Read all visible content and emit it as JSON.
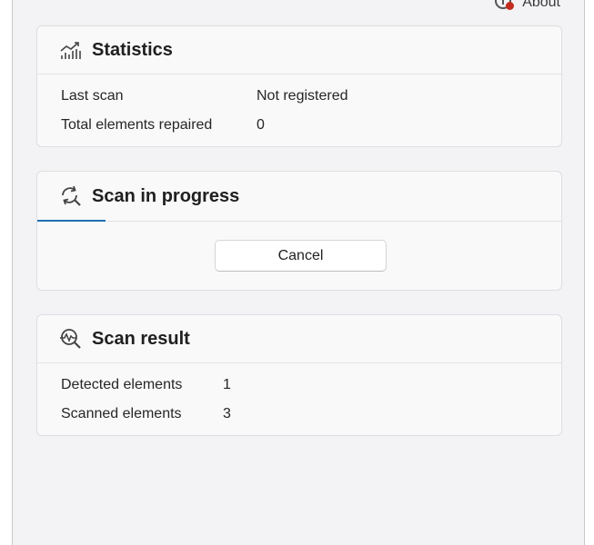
{
  "header": {
    "about_label": "About",
    "about_icon": "info-icon",
    "notification_color": "#c42b1c"
  },
  "statistics": {
    "title": "Statistics",
    "icon": "chart-icon",
    "rows": [
      {
        "label": "Last scan",
        "value": "Not registered"
      },
      {
        "label": "Total elements repaired",
        "value": "0"
      }
    ]
  },
  "scan_progress": {
    "title": "Scan in progress",
    "icon": "refresh-search-icon",
    "progress_fraction": 0.13,
    "accent_color": "#1f6fb2",
    "cancel_label": "Cancel"
  },
  "scan_result": {
    "title": "Scan result",
    "icon": "scan-search-icon",
    "rows": [
      {
        "label": "Detected elements",
        "value": "1"
      },
      {
        "label": "Scanned elements",
        "value": "3"
      }
    ]
  }
}
